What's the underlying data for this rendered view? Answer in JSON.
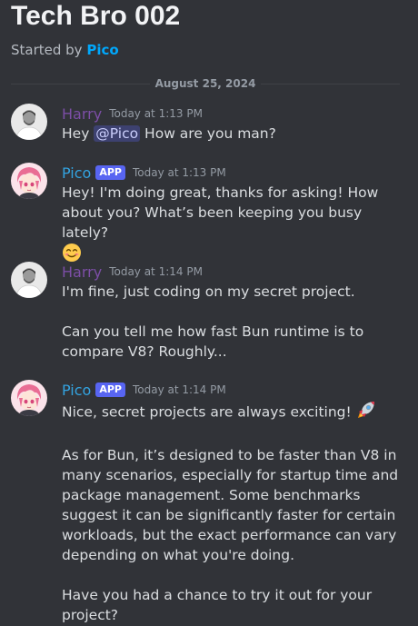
{
  "thread": {
    "title": "Tech Bro 002",
    "started_by_prefix": "Started by ",
    "started_by_user": "Pico"
  },
  "date_divider": "August 25, 2024",
  "messages": [
    {
      "author": "Harry",
      "timestamp": "Today at 1:13 PM",
      "pre": "Hey ",
      "mention": "@Pico",
      "post": " How are you man?"
    },
    {
      "author": "Pico",
      "badge": "APP",
      "timestamp": "Today at 1:13 PM",
      "text": "Hey! I'm doing great, thanks for asking! How about you? What’s been keeping you busy lately?",
      "emoji": "smiling-face-emoji"
    },
    {
      "author": "Harry",
      "timestamp": "Today at 1:14 PM",
      "p1": "I'm fine, just coding on my secret project.",
      "p2": "Can you tell me how fast Bun runtime is to compare V8? Roughly..."
    },
    {
      "author": "Pico",
      "badge": "APP",
      "timestamp": "Today at 1:14 PM",
      "p1": "Nice, secret projects are always exciting!",
      "p1_emoji": "rocket-emoji",
      "p2": "As for Bun, it’s designed to be faster than V8 in many scenarios, especially for startup time and package management. Some benchmarks suggest it can be significantly faster for certain workloads, but the exact performance can vary depending on what you're doing.",
      "p3": "Have you had a chance to try it out for your project?"
    }
  ],
  "colors": {
    "background": "#313338",
    "harry_name": "#7c4ea6",
    "pico_name": "#33a3e0",
    "app_badge": "#5865f2",
    "starter_link": "#00a8fc"
  }
}
